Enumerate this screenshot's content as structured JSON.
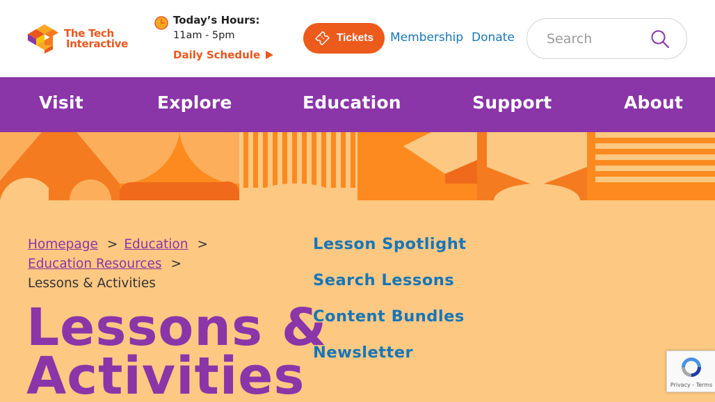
{
  "logo": {
    "line1": "The Tech",
    "line2": "Interactive"
  },
  "hours": {
    "title": "Today’s Hours:",
    "time": "11am - 5pm",
    "schedule_label": "Daily Schedule"
  },
  "header_links": {
    "tickets": "Tickets",
    "membership": "Membership",
    "donate": "Donate"
  },
  "search": {
    "placeholder": "Search"
  },
  "nav": [
    {
      "label": "Visit"
    },
    {
      "label": "Explore"
    },
    {
      "label": "Education"
    },
    {
      "label": "Support"
    },
    {
      "label": "About"
    }
  ],
  "breadcrumb": {
    "items": [
      "Homepage",
      "Education",
      "Education Resources"
    ],
    "separator": ">",
    "current": "Lessons & Activities"
  },
  "page": {
    "title_line1": "Lessons &",
    "title_line2": "Activities"
  },
  "side_links": [
    "Lesson Spotlight",
    "Search Lessons",
    "Content Bundles",
    "Newsletter"
  ],
  "recaptcha": {
    "terms": "Privacy - Terms"
  },
  "colors": {
    "brand_orange": "#ec5a1c",
    "nav_purple": "#8a35a8",
    "link_blue": "#1676b8",
    "content_bg": "#fdc882",
    "banner_orange": "#fc8a1e"
  },
  "icons": {
    "clock": "clock-icon",
    "ticket": "ticket-icon",
    "search": "search-icon",
    "play": "play-icon"
  }
}
